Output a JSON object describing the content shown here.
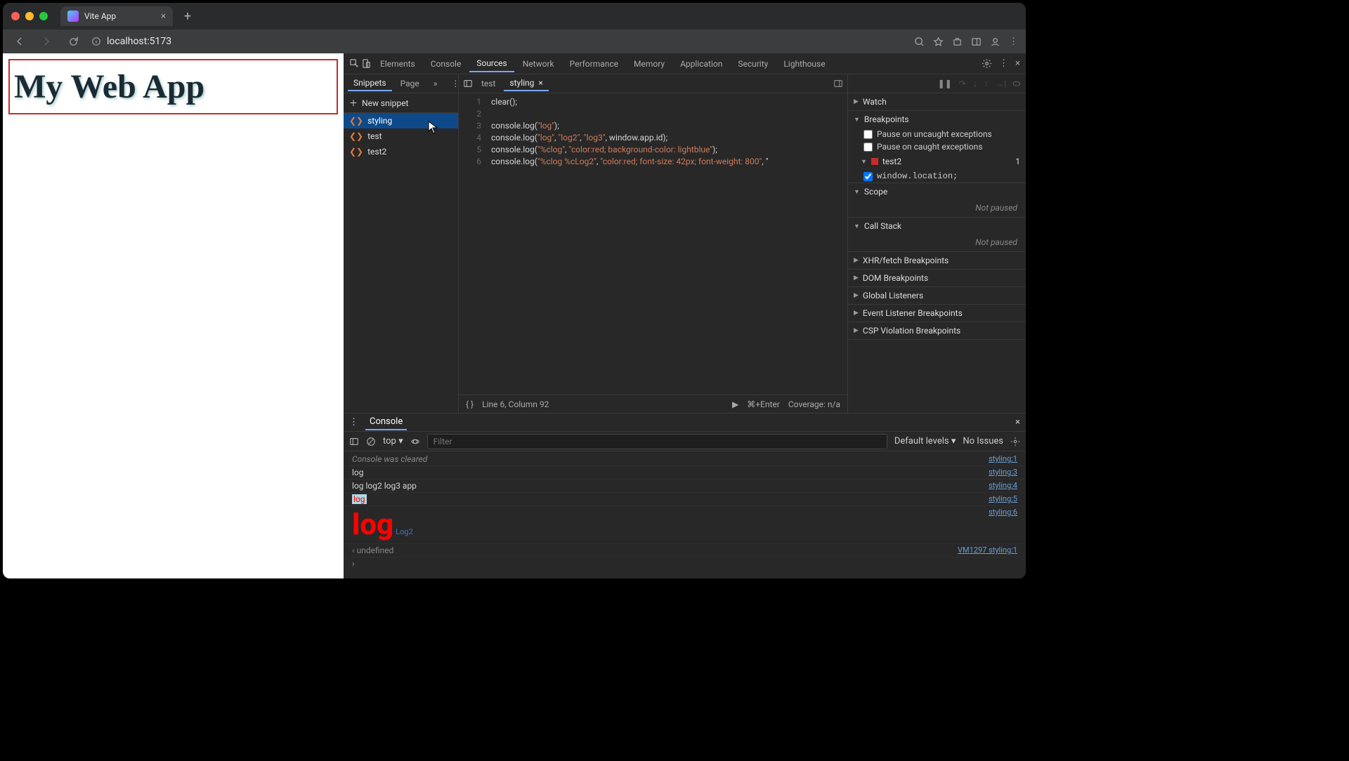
{
  "browser": {
    "tab_title": "Vite App",
    "url": "localhost:5173"
  },
  "page": {
    "heading": "My Web App"
  },
  "devtools": {
    "tabs": [
      "Elements",
      "Console",
      "Sources",
      "Network",
      "Performance",
      "Memory",
      "Application",
      "Security",
      "Lighthouse"
    ],
    "active_tab": "Sources"
  },
  "sources": {
    "nav_tabs": {
      "snippets": "Snippets",
      "page": "Page"
    },
    "new_snippet": "New snippet",
    "snippets": [
      "styling",
      "test",
      "test2"
    ],
    "open_files": [
      "test",
      "styling"
    ],
    "active_file": "styling",
    "code_lines": [
      "clear();",
      "",
      "console.log(\"log\");",
      "console.log(\"log\", \"log2\", \"log3\", window.app.id);",
      "console.log(\"%clog\", \"color:red; background-color: lightblue\");",
      "console.log(\"%clog %cLog2\", \"color:red; font-size: 42px; font-weight: 800\", \""
    ],
    "status": {
      "pos": "Line 6, Column 92",
      "run": "⌘+Enter",
      "coverage": "Coverage: n/a"
    }
  },
  "debugger": {
    "watch": "Watch",
    "breakpoints": "Breakpoints",
    "pause_uncaught": "Pause on uncaught exceptions",
    "pause_caught": "Pause on caught exceptions",
    "bp_file": "test2",
    "bp_line": "1",
    "bp_code": "window.location;",
    "scope": "Scope",
    "not_paused": "Not paused",
    "callstack": "Call Stack",
    "sections": [
      "XHR/fetch Breakpoints",
      "DOM Breakpoints",
      "Global Listeners",
      "Event Listener Breakpoints",
      "CSP Violation Breakpoints"
    ]
  },
  "console": {
    "title": "Console",
    "context": "top",
    "filter_ph": "Filter",
    "levels": "Default levels",
    "issues": "No Issues",
    "rows": [
      {
        "msg": "Console was cleared",
        "src": "styling:1",
        "cls": "italic"
      },
      {
        "msg": "log",
        "src": "styling:3"
      },
      {
        "msg": "log log2 log3 app",
        "src": "styling:4"
      },
      {
        "msg_html": "styled",
        "text": "log",
        "src": "styling:5"
      },
      {
        "msg_html": "big",
        "text": "log",
        "text2": "Log2",
        "src": "styling:6"
      }
    ],
    "return": "undefined",
    "ret_src": "VM1297 styling:1"
  }
}
